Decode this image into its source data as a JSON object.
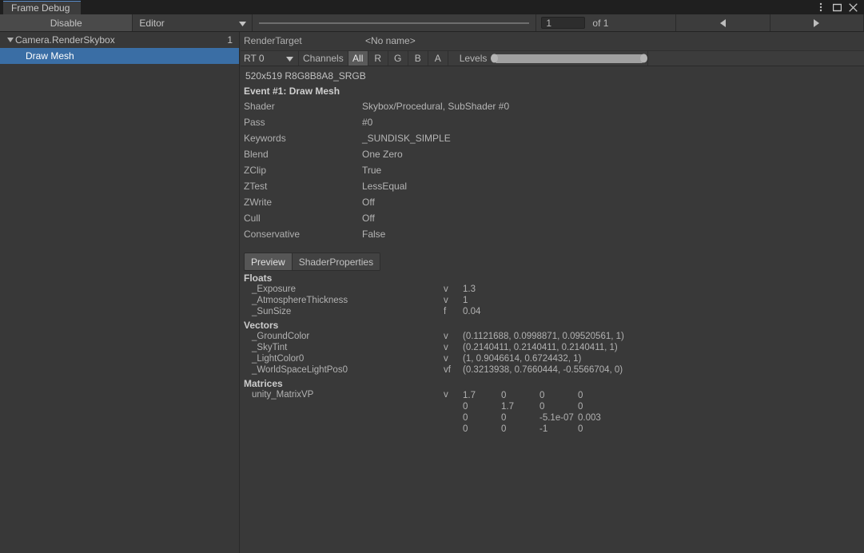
{
  "window": {
    "tab_title": "Frame Debug",
    "buttons": [
      {
        "name": "more-menu-icon",
        "glyph": "⋮"
      },
      {
        "name": "maximize-icon",
        "glyph": "▢"
      },
      {
        "name": "close-icon",
        "glyph": "✕"
      }
    ]
  },
  "toolbar": {
    "disable_label": "Disable",
    "target_dropdown": "Editor",
    "frame_value": "1",
    "frame_total": "of 1",
    "prev_glyph": "◀",
    "next_glyph": "▶",
    "caret_glyph": "▼"
  },
  "tree": {
    "rows": [
      {
        "label": "Camera.RenderSkybox",
        "count": "1",
        "depth": 0,
        "expanded": true,
        "selected": false
      },
      {
        "label": "Draw Mesh",
        "count": "",
        "depth": 1,
        "expanded": false,
        "selected": true
      }
    ],
    "arrow_glyph": "▼"
  },
  "details": {
    "render_target_label": "RenderTarget",
    "render_target_value": "<No name>",
    "rt_dropdown": "RT 0",
    "channels_label": "Channels",
    "channel_buttons": [
      {
        "label": "All",
        "active": true
      },
      {
        "label": "R",
        "active": false
      },
      {
        "label": "G",
        "active": false
      },
      {
        "label": "B",
        "active": false
      },
      {
        "label": "A",
        "active": false
      }
    ],
    "levels_label": "Levels",
    "resolution": "520x519 R8G8B8A8_SRGB",
    "event_title": "Event #1: Draw Mesh",
    "properties": [
      {
        "key": "Shader",
        "value": "Skybox/Procedural, SubShader #0"
      },
      {
        "key": "Pass",
        "value": "#0"
      },
      {
        "key": "Keywords",
        "value": "_SUNDISK_SIMPLE"
      },
      {
        "key": "Blend",
        "value": "One Zero"
      },
      {
        "key": "ZClip",
        "value": "True"
      },
      {
        "key": "ZTest",
        "value": "LessEqual"
      },
      {
        "key": "ZWrite",
        "value": "Off"
      },
      {
        "key": "Cull",
        "value": "Off"
      },
      {
        "key": "Conservative",
        "value": "False"
      }
    ],
    "subtabs": [
      {
        "label": "Preview",
        "active": true
      },
      {
        "label": "ShaderProperties",
        "active": false
      }
    ],
    "shader_properties": {
      "floats_title": "Floats",
      "floats": [
        {
          "name": "_Exposure",
          "flag": "v",
          "value": "1.3"
        },
        {
          "name": "_AtmosphereThickness",
          "flag": "v",
          "value": "1"
        },
        {
          "name": "_SunSize",
          "flag": "f",
          "value": "0.04"
        }
      ],
      "vectors_title": "Vectors",
      "vectors": [
        {
          "name": "_GroundColor",
          "flag": "v",
          "value": "(0.1121688, 0.0998871, 0.09520561, 1)"
        },
        {
          "name": "_SkyTint",
          "flag": "v",
          "value": "(0.2140411, 0.2140411, 0.2140411, 1)"
        },
        {
          "name": "_LightColor0",
          "flag": "v",
          "value": "(1, 0.9046614, 0.6724432, 1)"
        },
        {
          "name": "_WorldSpaceLightPos0",
          "flag": "vf",
          "value": "(0.3213938, 0.7660444, -0.5566704, 0)"
        }
      ],
      "matrices_title": "Matrices",
      "matrices": [
        {
          "name": "unity_MatrixVP",
          "flag": "v",
          "rows": [
            [
              "1.7",
              "0",
              "0",
              "0"
            ],
            [
              "0",
              "1.7",
              "0",
              "0"
            ],
            [
              "0",
              "0",
              "-5.1e-07",
              "0.003"
            ],
            [
              "0",
              "0",
              "-1",
              "0"
            ]
          ]
        }
      ]
    }
  },
  "colors": {
    "window_bg": "#383838",
    "panel_bg": "#393939",
    "toolbar_bg": "#3c3c3c",
    "titlebar_bg": "#1f1f1f",
    "selection_blue": "#3a6ea5",
    "tab_accent": "#5a8fd0",
    "text": "#b4b4b4"
  }
}
